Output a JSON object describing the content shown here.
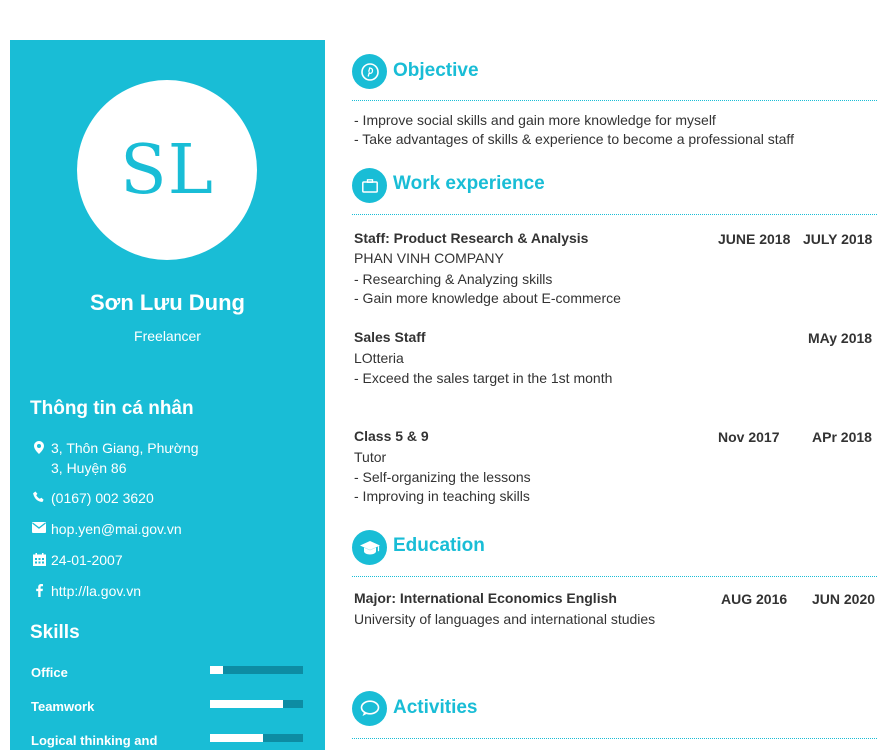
{
  "profile": {
    "initials": "SL",
    "name": "Sơn Lưu Dung",
    "role": "Freelancer"
  },
  "personal": {
    "heading": "Thông tin cá nhân",
    "address_line1": "3, Thôn Giang, Phường",
    "address_line2": "3, Huyện 86",
    "phone": "(0167) 002 3620",
    "email": "hop.yen@mai.gov.vn",
    "birthday": "24-01-2007",
    "website": "http://la.gov.vn"
  },
  "skills": {
    "heading": "Skills",
    "items": [
      {
        "label": "Office",
        "level": 0.14
      },
      {
        "label": "Teamwork",
        "level": 0.79
      },
      {
        "label": "Logical thinking and",
        "level": 0.57
      }
    ]
  },
  "objective": {
    "title": "Objective",
    "lines": [
      "- Improve social skills and gain more knowledge for myself",
      "- Take advantages of skills & experience to become a professional staff"
    ]
  },
  "work": {
    "title": "Work experience",
    "jobs": [
      {
        "position": "Staff: Product Research & Analysis",
        "company": "PHAN VINH COMPANY",
        "start": "JUNE 2018",
        "end": "JULY 2018",
        "details": [
          "- Researching & Analyzing skills",
          "- Gain more knowledge about E-commerce"
        ]
      },
      {
        "position": "Sales Staff",
        "company": "LOtteria",
        "start": "",
        "end": "MAy 2018",
        "details": [
          "- Exceed the sales target in the 1st month"
        ]
      },
      {
        "position": "Class 5 & 9",
        "company": "Tutor",
        "start": "Nov 2017",
        "end": "APr 2018",
        "details": [
          "- Self-organizing the lessons",
          "- Improving in teaching skills"
        ]
      }
    ]
  },
  "education": {
    "title": "Education",
    "major": "Major: International Economics English",
    "school": "University of languages and international studies",
    "start": "AUG 2016",
    "end": "JUN 2020"
  },
  "activities": {
    "title": "Activities"
  },
  "colors": {
    "accent": "#19bdd6",
    "bar_track": "#0d8ca3",
    "text": "#333333"
  },
  "icons": [
    "map-marker-icon",
    "phone-icon",
    "envelope-icon",
    "calendar-icon",
    "facebook-icon",
    "pinterest-icon",
    "briefcase-icon",
    "graduation-cap-icon",
    "chat-bubble-icon"
  ]
}
